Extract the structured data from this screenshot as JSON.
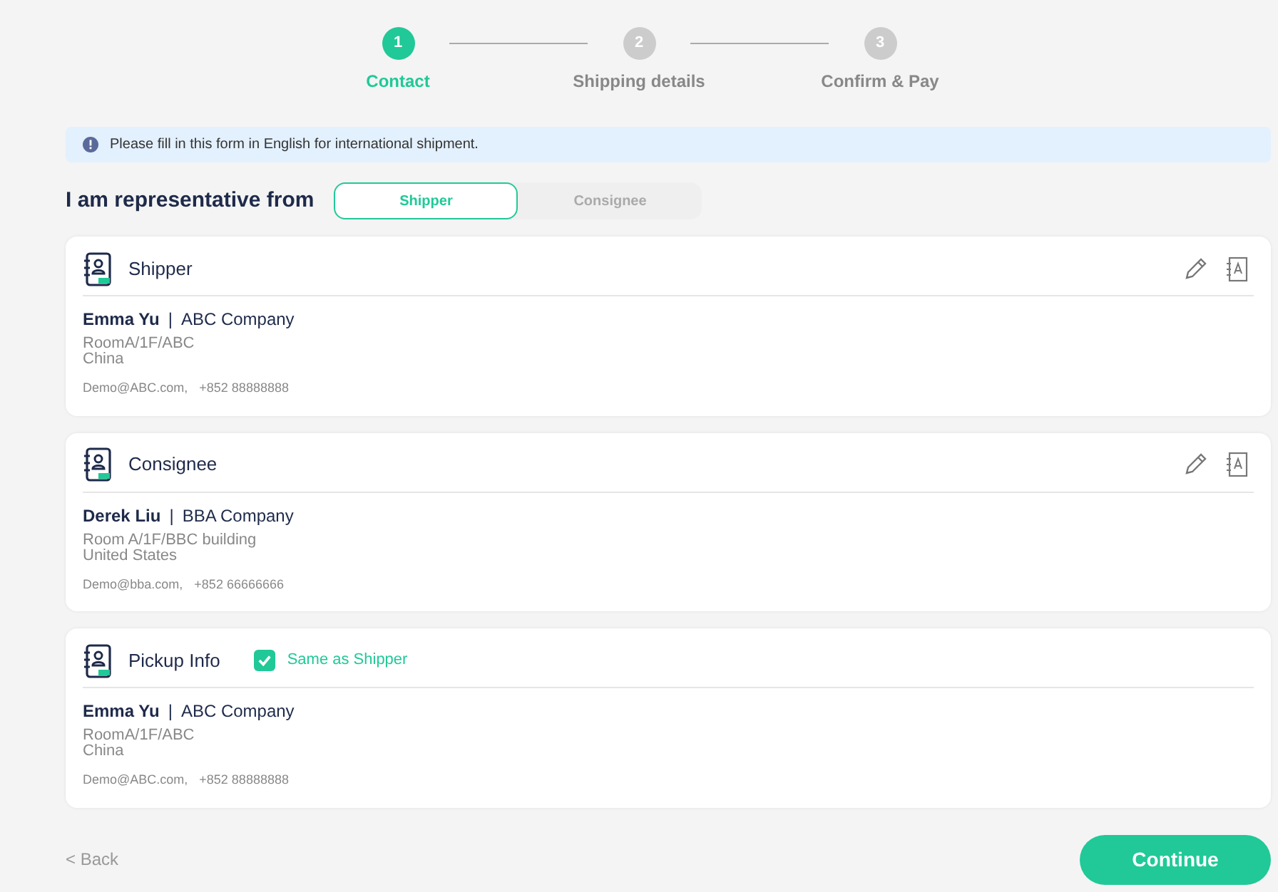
{
  "steps": [
    {
      "number": "1",
      "label": "Contact",
      "selected": true
    },
    {
      "number": "2",
      "label": "Shipping details",
      "selected": false
    },
    {
      "number": "3",
      "label": "Confirm & Pay",
      "selected": false
    }
  ],
  "notice": "Please fill in this form in English for international shipment.",
  "representative": {
    "label": "I am representative from",
    "options": [
      {
        "label": "Shipper",
        "selected": true
      },
      {
        "label": "Consignee",
        "selected": false
      }
    ]
  },
  "cards": [
    {
      "kind": "editable",
      "title": "Shipper",
      "name": "Emma Yu",
      "separator": "|",
      "company": "ABC Company",
      "address": [
        "RoomA/1F/ABC",
        "China"
      ],
      "email": "Demo@ABC.com,",
      "phone": "+852 88888888"
    },
    {
      "kind": "editable",
      "title": "Consignee",
      "name": "Derek Liu",
      "separator": "|",
      "company": "BBA Company",
      "address": [
        "Room A/1F/BBC building",
        "United States"
      ],
      "email": "Demo@bba.com,",
      "phone": "+852 66666666"
    },
    {
      "kind": "checkbox",
      "title": "Pickup Info",
      "checkbox": {
        "label": "Same as Shipper",
        "checked": true
      },
      "name": "Emma Yu",
      "separator": "|",
      "company": "ABC Company",
      "address": [
        "RoomA/1F/ABC",
        "China"
      ],
      "email": "Demo@ABC.com,",
      "phone": "+852 88888888"
    }
  ],
  "back": "< Back",
  "continue": "Continue"
}
